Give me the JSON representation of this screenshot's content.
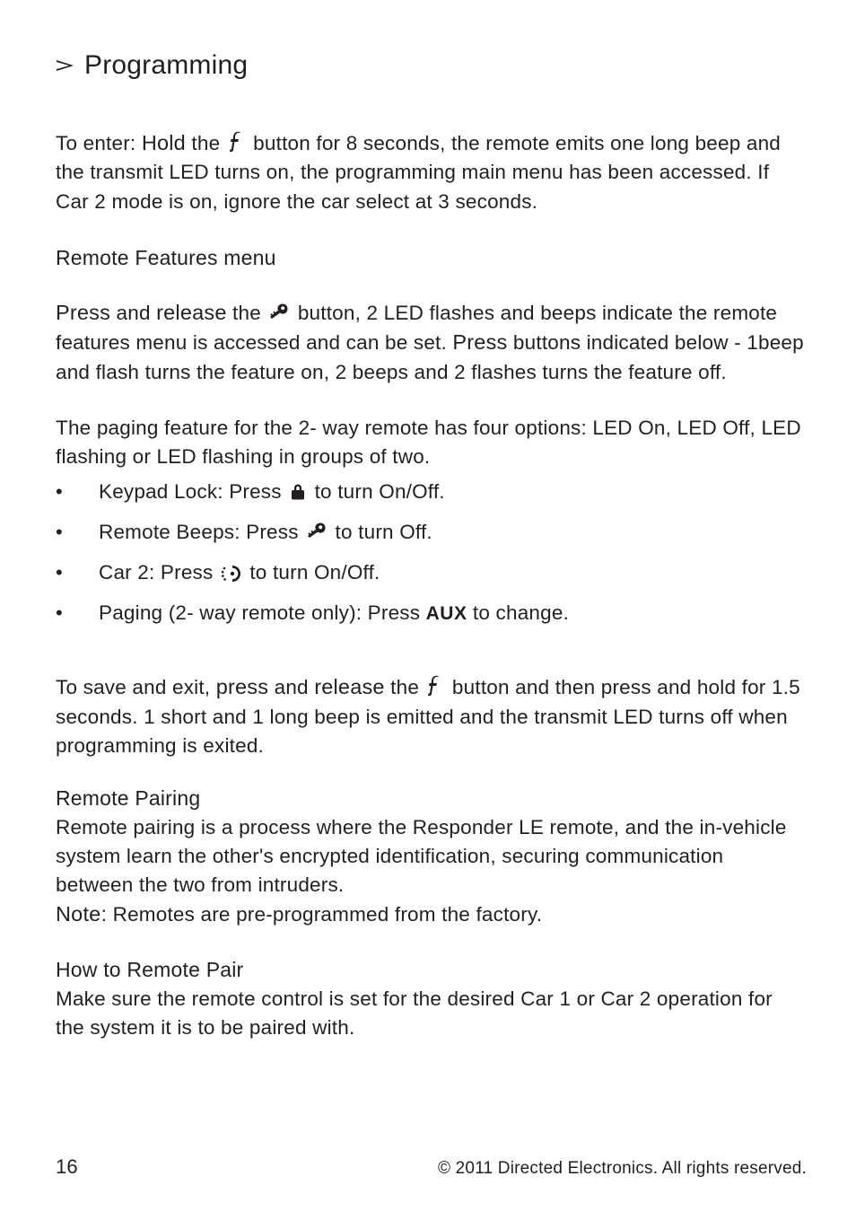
{
  "title": "Programming",
  "intro_pre": "To enter: ",
  "intro_hold": "Hold",
  "intro_mid": " the ",
  "intro_post": " button for 8 seconds, the remote emits one long beep and the transmit LED turns on, the programming main menu has been accessed. If Car 2 mode is on, ignore the car select at 3 seconds.",
  "rfm_heading": "Remote Features menu",
  "rfm_p1_press": "Press",
  "rfm_p1_a": " and ",
  "rfm_p1_release": "release",
  "rfm_p1_b": " the ",
  "rfm_p1_c": " button, 2 LED flashes and beeps indicate the remote features menu is accessed and can be set. ",
  "rfm_p1_press2": "Press",
  "rfm_p1_d": " buttons indicated below - 1beep and flash turns the feature on, 2 beeps and 2 flashes turns the feature off.",
  "rfm_p2": "The paging feature for the 2- way remote has four options: LED On, LED Off, LED flashing or LED flashing in groups of two.",
  "li1_a": "Keypad Lock: Press ",
  "li1_b": " to turn On/Off.",
  "li2_a": "Remote Beeps: Press ",
  "li2_b": " to turn Off.",
  "li3_a": "Car 2: Press ",
  "li3_b": " to turn On/Off.",
  "li4_a": "Paging (2- way remote only): Press ",
  "li4_aux": "AUX",
  "li4_b": " to change.",
  "save_a": "To save and exit, ",
  "save_press": "press",
  "save_b": " and ",
  "save_release": "release",
  "save_c": " the ",
  "save_d": " button and then press and hold for 1.5 seconds. 1 short and 1 long beep is emitted and the transmit LED turns off when programming is exited.",
  "rp_heading": "Remote Pairing",
  "rp_body": "Remote pairing is a process where the Responder LE remote, and the in-vehicle system learn the other's encrypted identification, securing communication between the two from intruders.",
  "rp_note_label": "Note:",
  "rp_note_body": " Remotes are pre-programmed from the factory.",
  "howto_heading": "How to Remote Pair",
  "howto_body": "Make sure the remote control is set for the desired Car 1 or Car 2 operation for the system it is to be paired with.",
  "page_number": "16",
  "copyright": "© 2011 Directed Electronics. All rights reserved."
}
